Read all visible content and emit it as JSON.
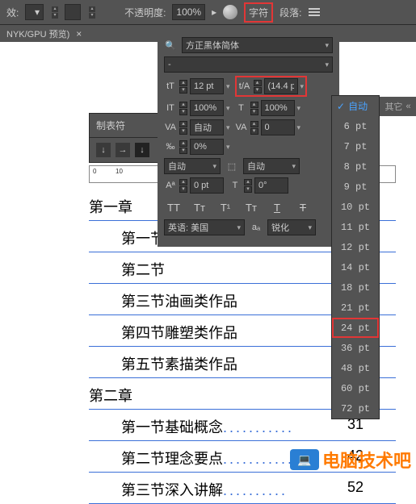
{
  "topbar": {
    "effect_label": "效:",
    "opacity_label": "不透明度:",
    "opacity_value": "100%",
    "char_tab": "字符",
    "para_tab": "段落:"
  },
  "doctab": {
    "title": "NYK/GPU 预览)",
    "close": "×"
  },
  "panel": {
    "font_family": "方正黑体简体",
    "font_style": "-",
    "size_icon": "tT",
    "size_value": "12 pt",
    "leading_icon": "t/A",
    "leading_value": "(14.4 p",
    "vscale_icon": "IT",
    "vscale_value": "100%",
    "hscale_icon": "T",
    "hscale_value": "100%",
    "kerning_icon": "VA",
    "kerning_value": "自动",
    "tracking_icon": "VA",
    "tracking_value": "0",
    "baseline_icon": "‰",
    "baseline_value": "0%",
    "auto_label": "自动",
    "auto_label2": "自动",
    "bshift_icon": "Aª",
    "bshift_value": "0 pt",
    "rotate_icon": "T",
    "rotate_value": "0°",
    "lang_label": "英语: 美国",
    "aa_icon": "aₐ",
    "aa_label": "锐化",
    "tt": [
      "TT",
      "Tт",
      "T¹",
      "Tт",
      "T"
    ]
  },
  "tabstops": {
    "title": "制表符",
    "icons": [
      "↓",
      "→",
      "↓"
    ]
  },
  "ruler": {
    "marks": [
      "0",
      "10"
    ]
  },
  "dropdown": {
    "other_label": "其它",
    "auto": "自动",
    "items": [
      "6 pt",
      "7 pt",
      "8 pt",
      "9 pt",
      "10 pt",
      "11 pt",
      "12 pt",
      "14 pt",
      "18 pt",
      "21 pt",
      "24 pt",
      "36 pt",
      "48 pt",
      "60 pt",
      "72 pt"
    ],
    "highlight": "24 pt"
  },
  "document": {
    "ch1": "第一章",
    "ch2": "第二章",
    "s1_1": "第一节",
    "s1_2": "第二节",
    "s1_3": "第三节油画类作品",
    "s1_4": "第四节雕塑类作品",
    "s1_5": "第五节素描类作品",
    "s2_1": "第一节基础概念",
    "s2_2": "第二节理念要点",
    "s2_3": "第三节深入讲解",
    "p2_1": "31",
    "p2_2": "42",
    "p2_3": "52"
  },
  "watermark": {
    "text": "电脑技术吧"
  }
}
